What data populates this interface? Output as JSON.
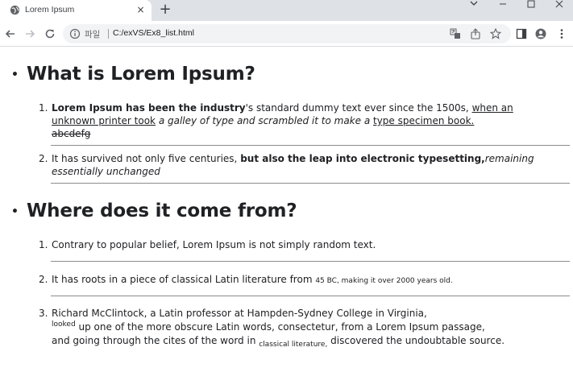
{
  "browser": {
    "tab_title": "Lorem Ipsum",
    "new_tab_symbol": "+",
    "tab_close_symbol": "×",
    "site_label": "파일",
    "url": "C:/exVS/Ex8_list.html",
    "icons": [
      "back-icon",
      "forward-icon",
      "reload-icon",
      "info-icon",
      "translate-icon",
      "share-icon",
      "bookmark-star-icon",
      "side-panel-icon",
      "profile-icon",
      "menu-icon",
      "tab-search-icon",
      "minimize-icon",
      "maximize-icon",
      "close-window-icon"
    ]
  },
  "content": {
    "section1": {
      "bullet": "•",
      "heading": "What is Lorem Ipsum?",
      "item1": {
        "num": "1.",
        "bold": "Lorem Ipsum has been the industry",
        "plain1": "'s standard dummy text ever since the 1500s, ",
        "under1": "when an unknown printer took",
        "italic1": " a galley of type and scrambled it to make a ",
        "under2": "type specimen book.",
        "strike": "abcdefg"
      },
      "item2": {
        "num": "2.",
        "plain": "It has survived not only five centuries, ",
        "bold": "but also the leap into electronic typesetting,",
        "italic": "remaining essentially unchanged"
      }
    },
    "section2": {
      "bullet": "•",
      "heading": "Where does it come from?",
      "item1": {
        "num": "1.",
        "text": "Contrary to popular belief, Lorem Ipsum is not simply random text."
      },
      "item2": {
        "num": "2.",
        "text": "It has roots in a piece of classical Latin literature from ",
        "small": "45 BC, making it over 2000 years old."
      },
      "item3": {
        "num": "3.",
        "line1": "Richard McClintock, a Latin professor at Hampden-Sydney College in Virginia,",
        "sup": "looked",
        "line2": " up one of the more obscure Latin words, consectetur, from a Lorem Ipsum passage,",
        "line3a": "and going through the cites of the word in ",
        "sub": "classical literature,",
        "line3b": " discovered the undoubtable source."
      }
    }
  }
}
